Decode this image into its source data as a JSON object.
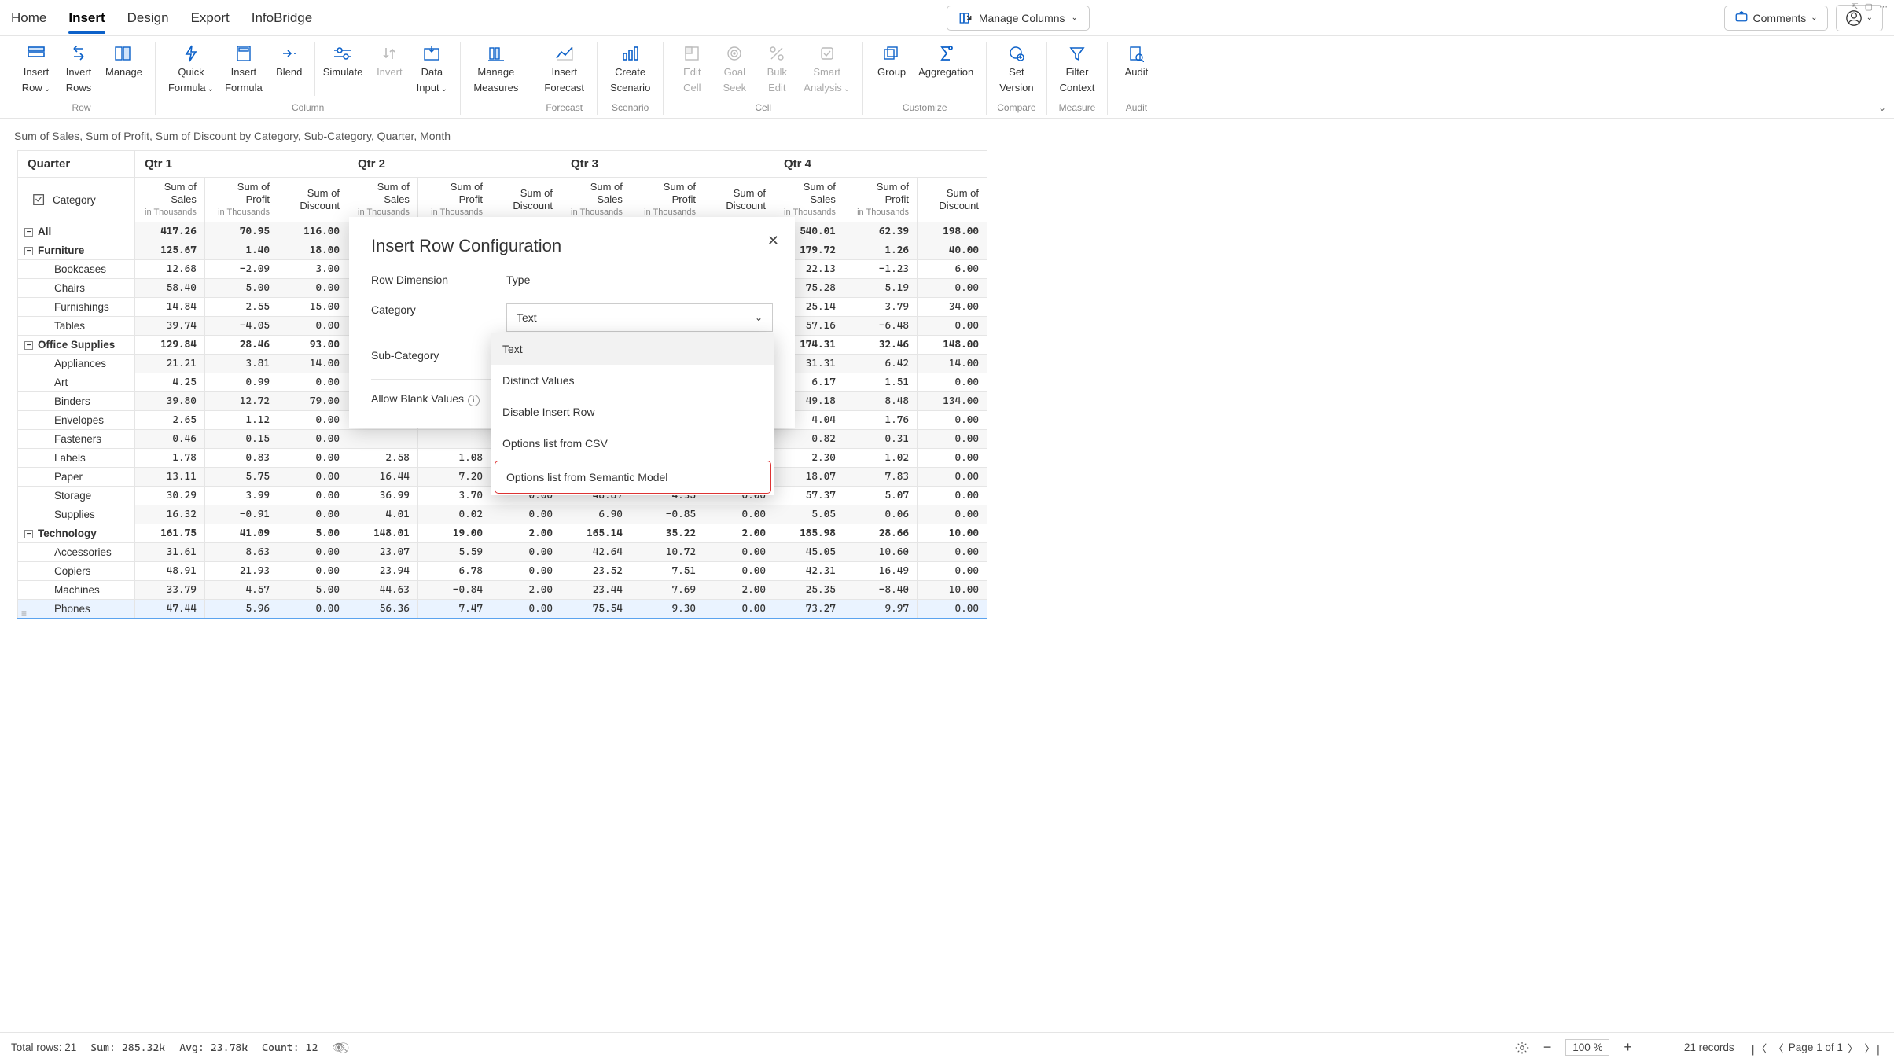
{
  "tabs": {
    "t0": "Home",
    "t1": "Insert",
    "t2": "Design",
    "t3": "Export",
    "t4": "InfoBridge"
  },
  "toolbar": {
    "manage_columns": "Manage Columns",
    "comments": "Comments"
  },
  "ribbon": {
    "g_row": "Row",
    "g_col": "Column",
    "g_fc": "Forecast",
    "g_scn": "Scenario",
    "g_cell": "Cell",
    "g_cust": "Customize",
    "g_cmp": "Compare",
    "g_meas": "Measure",
    "g_aud": "Audit",
    "insert_row1": "Insert",
    "insert_row2": "Row",
    "invert_rows1": "Invert",
    "invert_rows2": "Rows",
    "manage_rows1": "Manage",
    "quick1": "Quick",
    "quick2": "Formula",
    "insert_formula1": "Insert",
    "insert_formula2": "Formula",
    "blend": "Blend",
    "simulate": "Simulate",
    "invert": "Invert",
    "data1": "Data",
    "data2": "Input",
    "manage_meas1": "Manage",
    "manage_meas2": "Measures",
    "insert_fc1": "Insert",
    "insert_fc2": "Forecast",
    "create_sc1": "Create",
    "create_sc2": "Scenario",
    "edit_cell1": "Edit",
    "edit_cell2": "Cell",
    "goal1": "Goal",
    "goal2": "Seek",
    "bulk1": "Bulk",
    "bulk2": "Edit",
    "smart1": "Smart",
    "smart2": "Analysis",
    "group": "Group",
    "aggr": "Aggregation",
    "set_ver1": "Set",
    "set_ver2": "Version",
    "filter1": "Filter",
    "filter2": "Context",
    "audit": "Audit"
  },
  "subtitle": "Sum of Sales, Sum of Profit, Sum of Discount by Category, Sub-Category, Quarter, Month",
  "gridhdr": {
    "quarter": "Quarter",
    "q1": "Qtr 1",
    "q2": "Qtr 2",
    "q3": "Qtr 3",
    "q4": "Qtr 4",
    "category": "Category",
    "sales": "Sum of Sales",
    "profit": "Sum of Profit",
    "discount": "Sum of",
    "discount2": "Discount",
    "unit": "in Thousands"
  },
  "rows": {
    "all": "All",
    "furn": "Furniture",
    "book": "Bookcases",
    "chairs": "Chairs",
    "furnsh": "Furnishings",
    "tables": "Tables",
    "off": "Office Supplies",
    "appl": "Appliances",
    "art": "Art",
    "bind": "Binders",
    "env": "Envelopes",
    "fast": "Fasteners",
    "lab": "Labels",
    "paper": "Paper",
    "stor": "Storage",
    "supp": "Supplies",
    "tech": "Technology",
    "acc": "Accessories",
    "cop": "Copiers",
    "mach": "Machines",
    "phones": "Phones"
  },
  "data": {
    "all": {
      "q1": [
        "417.26",
        "70.95",
        "116.00"
      ],
      "q4": [
        "540.01",
        "62.39",
        "198.00"
      ]
    },
    "furn": {
      "q1": [
        "125.67",
        "1.40",
        "18.00"
      ],
      "q4": [
        "179.72",
        "1.26",
        "40.00"
      ]
    },
    "book": {
      "q1": [
        "12.68",
        "-2.09",
        "3.00"
      ],
      "q4": [
        "22.13",
        "-1.23",
        "6.00"
      ]
    },
    "chairs": {
      "q1": [
        "58.40",
        "5.00",
        "0.00"
      ],
      "q4": [
        "75.28",
        "5.19",
        "0.00"
      ]
    },
    "furnsh": {
      "q1": [
        "14.84",
        "2.55",
        "15.00"
      ],
      "q4": [
        "25.14",
        "3.79",
        "34.00"
      ]
    },
    "tables": {
      "q1": [
        "39.74",
        "-4.05",
        "0.00"
      ],
      "q4": [
        "57.16",
        "-6.48",
        "0.00"
      ]
    },
    "off": {
      "q1": [
        "129.84",
        "28.46",
        "93.00"
      ],
      "q4": [
        "174.31",
        "32.46",
        "148.00"
      ]
    },
    "appl": {
      "q1": [
        "21.21",
        "3.81",
        "14.00"
      ],
      "q4": [
        "31.31",
        "6.42",
        "14.00"
      ]
    },
    "art": {
      "q1": [
        "4.25",
        "0.99",
        "0.00"
      ],
      "q4": [
        "6.17",
        "1.51",
        "0.00"
      ]
    },
    "bind": {
      "q1": [
        "39.80",
        "12.72",
        "79.00"
      ],
      "q4": [
        "49.18",
        "8.48",
        "134.00"
      ]
    },
    "env": {
      "q1": [
        "2.65",
        "1.12",
        "0.00"
      ],
      "q4": [
        "4.04",
        "1.76",
        "0.00"
      ]
    },
    "fast": {
      "q1": [
        "0.46",
        "0.15",
        "0.00"
      ],
      "q4": [
        "0.82",
        "0.31",
        "0.00"
      ]
    },
    "lab": {
      "q1": [
        "1.78",
        "0.83",
        "0.00"
      ],
      "q2": [
        "2.58",
        "1.08",
        ""
      ],
      "q4": [
        "2.30",
        "1.02",
        "0.00"
      ]
    },
    "paper": {
      "q1": [
        "13.11",
        "5.75",
        "0.00"
      ],
      "q2": [
        "16.44",
        "7.20",
        ""
      ],
      "q4": [
        "18.07",
        "7.83",
        "0.00"
      ]
    },
    "stor": {
      "q1": [
        "30.29",
        "3.99",
        "0.00"
      ],
      "q2": [
        "36.99",
        "3.70",
        "0.00"
      ],
      "q3": [
        "48.87",
        "4.35",
        "0.00"
      ],
      "q4": [
        "57.37",
        "5.07",
        "0.00"
      ]
    },
    "supp": {
      "q1": [
        "16.32",
        "-0.91",
        "0.00"
      ],
      "q2": [
        "4.01",
        "0.02",
        "0.00"
      ],
      "q3": [
        "6.90",
        "-0.85",
        "0.00"
      ],
      "q4": [
        "5.05",
        "0.06",
        "0.00"
      ]
    },
    "tech": {
      "q1": [
        "161.75",
        "41.09",
        "5.00"
      ],
      "q2": [
        "148.01",
        "19.00",
        "2.00"
      ],
      "q3": [
        "165.14",
        "35.22",
        "2.00"
      ],
      "q4": [
        "185.98",
        "28.66",
        "10.00"
      ]
    },
    "acc": {
      "q1": [
        "31.61",
        "8.63",
        "0.00"
      ],
      "q2": [
        "23.07",
        "5.59",
        "0.00"
      ],
      "q3": [
        "42.64",
        "10.72",
        "0.00"
      ],
      "q4": [
        "45.05",
        "10.60",
        "0.00"
      ]
    },
    "cop": {
      "q1": [
        "48.91",
        "21.93",
        "0.00"
      ],
      "q2": [
        "23.94",
        "6.78",
        "0.00"
      ],
      "q3": [
        "23.52",
        "7.51",
        "0.00"
      ],
      "q4": [
        "42.31",
        "16.49",
        "0.00"
      ]
    },
    "mach": {
      "q1": [
        "33.79",
        "4.57",
        "5.00"
      ],
      "q2": [
        "44.63",
        "-0.84",
        "2.00"
      ],
      "q3": [
        "23.44",
        "7.69",
        "2.00"
      ],
      "q4": [
        "25.35",
        "-8.40",
        "10.00"
      ]
    },
    "phones": {
      "q1": [
        "47.44",
        "5.96",
        "0.00"
      ],
      "q2": [
        "56.36",
        "7.47",
        "0.00"
      ],
      "q3": [
        "75.54",
        "9.30",
        "0.00"
      ],
      "q4": [
        "73.27",
        "9.97",
        "0.00"
      ]
    }
  },
  "modal": {
    "title": "Insert Row Configuration",
    "row_dim": "Row Dimension",
    "type": "Type",
    "cat": "Category",
    "sel_val": "Text",
    "subcat": "Sub-Category",
    "allow_blank": "Allow Blank Values"
  },
  "dropdown": {
    "o1": "Text",
    "o2": "Distinct Values",
    "o3": "Disable Insert Row",
    "o4": "Options list from CSV",
    "o5": "Options list from Semantic Model"
  },
  "status": {
    "total": "Total rows: 21",
    "sum": "Sum: 285.32k",
    "avg": "Avg: 23.78k",
    "count": "Count: 12",
    "zoom": "100 %",
    "records": "21 records",
    "page": "Page 1 of 1"
  }
}
